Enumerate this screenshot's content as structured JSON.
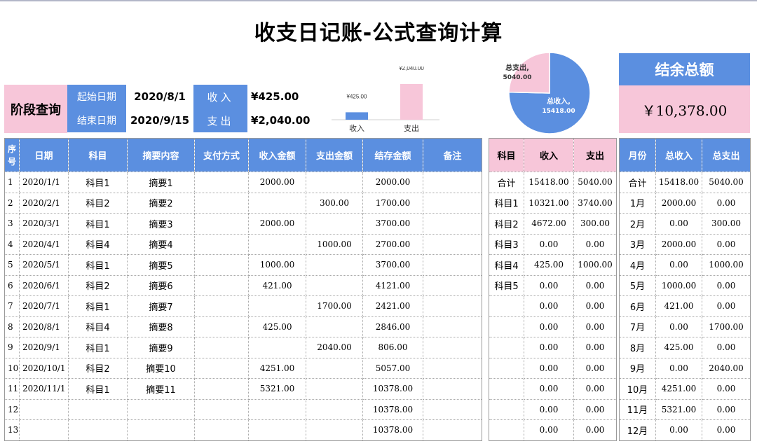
{
  "title": "收支日记账-公式查询计算",
  "query": {
    "label": "阶段查询",
    "start_label": "起始日期",
    "start_value": "2020/8/1",
    "end_label": "结束日期",
    "end_value": "2020/9/15",
    "income_label": "收入",
    "income_value": "¥425.00",
    "expense_label": "支出",
    "expense_value": "¥2,040.00"
  },
  "chart_data": [
    {
      "type": "bar",
      "categories": [
        "收入",
        "支出"
      ],
      "values": [
        425,
        2040
      ],
      "data_labels": [
        "¥425.00",
        "¥2,040.00"
      ],
      "colors": [
        "#5b8fe0",
        "#f7c6d9"
      ],
      "title": "",
      "xlabel": "",
      "ylabel": "",
      "ylim": [
        0,
        2800
      ],
      "grid": false
    },
    {
      "type": "pie",
      "categories": [
        "总收入",
        "总支出"
      ],
      "values": [
        15418.0,
        5040.0
      ],
      "data_labels": [
        "总收入,\n15418.00",
        "总支出,\n5040.00"
      ],
      "colors": [
        "#5b8fe0",
        "#f7c6d9"
      ],
      "title": ""
    }
  ],
  "balance": {
    "label": "结余总额",
    "value": "￥10,378.00"
  },
  "main_table": {
    "headers": [
      "序号",
      "日期",
      "科目",
      "摘要内容",
      "支付方式",
      "收入金额",
      "支出金额",
      "结存金额",
      "备注"
    ],
    "rows": [
      [
        "1",
        "2020/1/1",
        "科目1",
        "摘要1",
        "",
        "2000.00",
        "",
        "2000.00",
        ""
      ],
      [
        "2",
        "2020/2/1",
        "科目2",
        "摘要2",
        "",
        "",
        "300.00",
        "1700.00",
        ""
      ],
      [
        "3",
        "2020/3/1",
        "科目1",
        "摘要3",
        "",
        "2000.00",
        "",
        "3700.00",
        ""
      ],
      [
        "4",
        "2020/4/1",
        "科目4",
        "摘要4",
        "",
        "",
        "1000.00",
        "2700.00",
        ""
      ],
      [
        "5",
        "2020/5/1",
        "科目1",
        "摘要5",
        "",
        "1000.00",
        "",
        "3700.00",
        ""
      ],
      [
        "6",
        "2020/6/1",
        "科目2",
        "摘要6",
        "",
        "421.00",
        "",
        "4121.00",
        ""
      ],
      [
        "7",
        "2020/7/1",
        "科目1",
        "摘要7",
        "",
        "",
        "1700.00",
        "2421.00",
        ""
      ],
      [
        "8",
        "2020/8/1",
        "科目4",
        "摘要8",
        "",
        "425.00",
        "",
        "2846.00",
        ""
      ],
      [
        "9",
        "2020/9/1",
        "科目1",
        "摘要9",
        "",
        "",
        "2040.00",
        "806.00",
        ""
      ],
      [
        "10",
        "2020/10/1",
        "科目2",
        "摘要10",
        "",
        "4251.00",
        "",
        "5057.00",
        ""
      ],
      [
        "11",
        "2020/11/1",
        "科目1",
        "摘要11",
        "",
        "5321.00",
        "",
        "10378.00",
        ""
      ],
      [
        "12",
        "",
        "",
        "",
        "",
        "",
        "",
        "10378.00",
        ""
      ],
      [
        "13",
        "",
        "",
        "",
        "",
        "",
        "",
        "10378.00",
        ""
      ]
    ]
  },
  "subject_table": {
    "headers": [
      "科目",
      "收入",
      "支出"
    ],
    "rows": [
      [
        "合计",
        "15418.00",
        "5040.00"
      ],
      [
        "科目1",
        "10321.00",
        "3740.00"
      ],
      [
        "科目2",
        "4672.00",
        "300.00"
      ],
      [
        "科目3",
        "0.00",
        "0.00"
      ],
      [
        "科目4",
        "425.00",
        "1000.00"
      ],
      [
        "科目5",
        "0.00",
        "0.00"
      ],
      [
        "",
        "0.00",
        "0.00"
      ],
      [
        "",
        "0.00",
        "0.00"
      ],
      [
        "",
        "0.00",
        "0.00"
      ],
      [
        "",
        "0.00",
        "0.00"
      ],
      [
        "",
        "0.00",
        "0.00"
      ],
      [
        "",
        "0.00",
        "0.00"
      ],
      [
        "",
        "0.00",
        "0.00"
      ]
    ]
  },
  "month_table": {
    "headers": [
      "月份",
      "总收入",
      "总支出"
    ],
    "rows": [
      [
        "合计",
        "15418.00",
        "5040.00"
      ],
      [
        "1月",
        "2000.00",
        "0.00"
      ],
      [
        "2月",
        "0.00",
        "300.00"
      ],
      [
        "3月",
        "2000.00",
        "0.00"
      ],
      [
        "4月",
        "0.00",
        "1000.00"
      ],
      [
        "5月",
        "1000.00",
        "0.00"
      ],
      [
        "6月",
        "421.00",
        "0.00"
      ],
      [
        "7月",
        "0.00",
        "1700.00"
      ],
      [
        "8月",
        "425.00",
        "0.00"
      ],
      [
        "9月",
        "0.00",
        "2040.00"
      ],
      [
        "10月",
        "4251.00",
        "0.00"
      ],
      [
        "11月",
        "5321.00",
        "0.00"
      ],
      [
        "12月",
        "0.00",
        "0.00"
      ]
    ]
  }
}
